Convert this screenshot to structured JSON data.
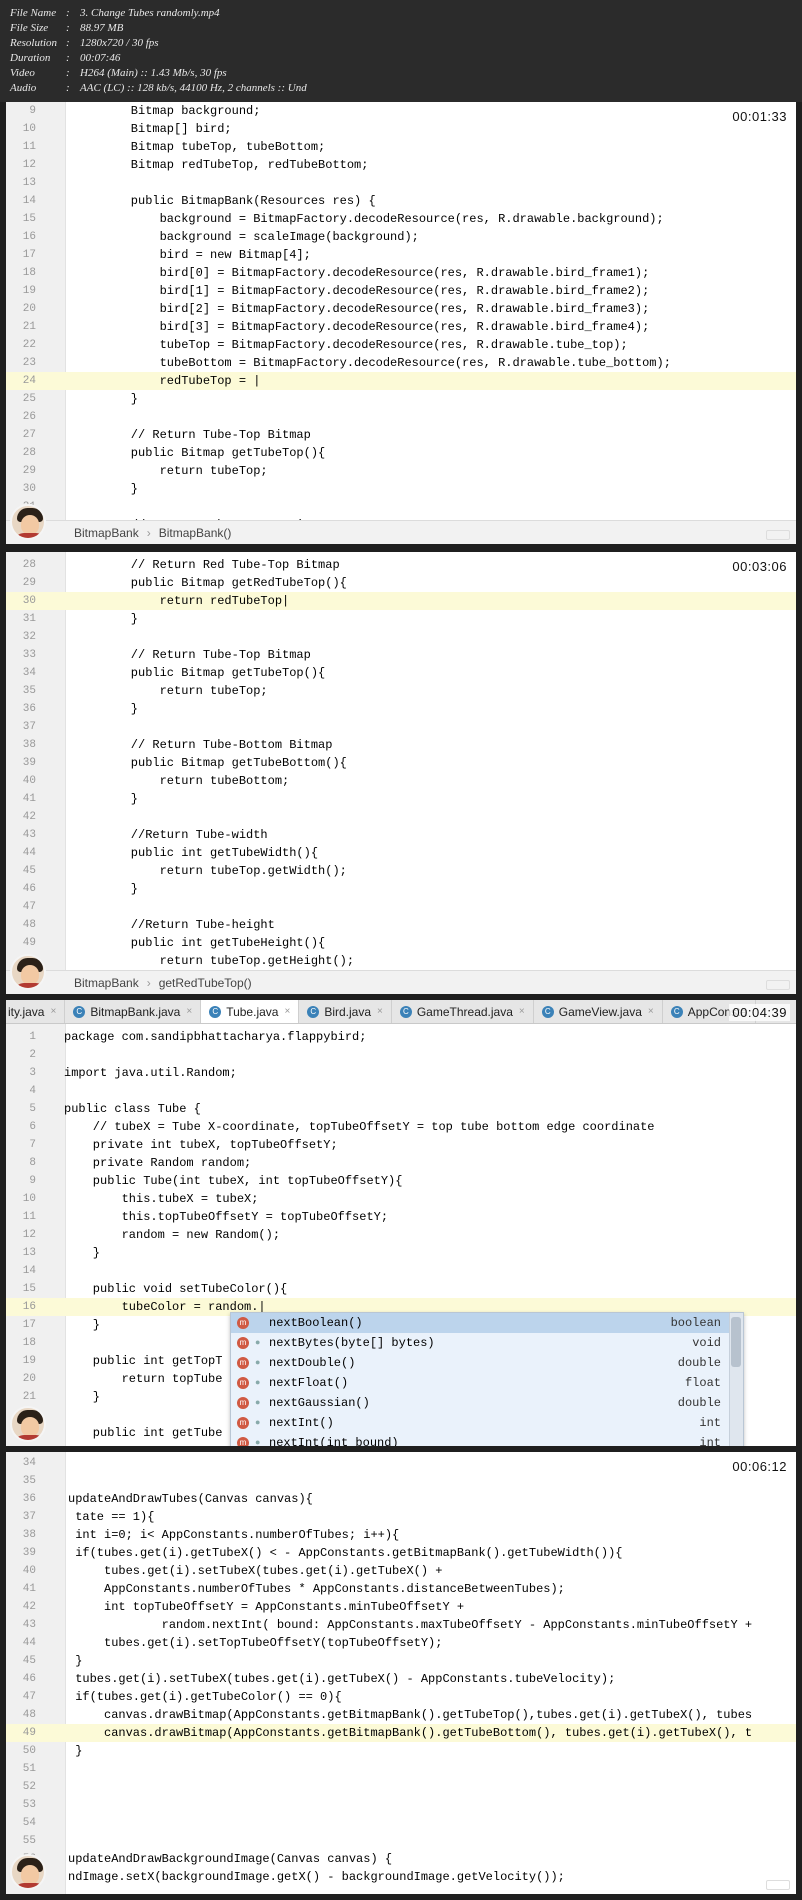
{
  "file_info": [
    {
      "key": "File Name",
      "value": "3. Change Tubes randomly.mp4"
    },
    {
      "key": "File Size",
      "value": "88.97 MB"
    },
    {
      "key": "Resolution",
      "value": "1280x720 / 30 fps"
    },
    {
      "key": "Duration",
      "value": "00:07:46"
    },
    {
      "key": "Video",
      "value": "H264 (Main) :: 1.43 Mb/s, 30 fps"
    },
    {
      "key": "Audio",
      "value": "AAC (LC) :: 128 kb/s, 44100 Hz, 2 channels :: Und"
    }
  ],
  "panels": [
    {
      "timestamp": "00:01:33",
      "breadcrumb": [
        "BitmapBank",
        "BitmapBank()"
      ],
      "lines": [
        {
          "n": "9",
          "t": "    Bitmap background;"
        },
        {
          "n": "10",
          "t": "    Bitmap[] bird;"
        },
        {
          "n": "11",
          "t": "    Bitmap tubeTop, tubeBottom;"
        },
        {
          "n": "12",
          "t": "    Bitmap redTubeTop, redTubeBottom;"
        },
        {
          "n": "13",
          "t": ""
        },
        {
          "n": "14",
          "t": "    public BitmapBank(Resources res) {"
        },
        {
          "n": "15",
          "t": "        background = BitmapFactory.decodeResource(res, R.drawable.background);"
        },
        {
          "n": "16",
          "t": "        background = scaleImage(background);"
        },
        {
          "n": "17",
          "t": "        bird = new Bitmap[4];"
        },
        {
          "n": "18",
          "t": "        bird[0] = BitmapFactory.decodeResource(res, R.drawable.bird_frame1);"
        },
        {
          "n": "19",
          "t": "        bird[1] = BitmapFactory.decodeResource(res, R.drawable.bird_frame2);"
        },
        {
          "n": "20",
          "t": "        bird[2] = BitmapFactory.decodeResource(res, R.drawable.bird_frame3);"
        },
        {
          "n": "21",
          "t": "        bird[3] = BitmapFactory.decodeResource(res, R.drawable.bird_frame4);"
        },
        {
          "n": "22",
          "t": "        tubeTop = BitmapFactory.decodeResource(res, R.drawable.tube_top);"
        },
        {
          "n": "23",
          "t": "        tubeBottom = BitmapFactory.decodeResource(res, R.drawable.tube_bottom);"
        },
        {
          "n": "24",
          "t": "        redTubeTop = |",
          "cur": true
        },
        {
          "n": "25",
          "t": "    }"
        },
        {
          "n": "26",
          "t": ""
        },
        {
          "n": "27",
          "t": "    // Return Tube-Top Bitmap"
        },
        {
          "n": "28",
          "t": "    public Bitmap getTubeTop(){"
        },
        {
          "n": "29",
          "t": "        return tubeTop;"
        },
        {
          "n": "30",
          "t": "    }"
        },
        {
          "n": "31",
          "t": ""
        },
        {
          "n": "32",
          "t": "    // Return Tube-Bottom Bitmap"
        }
      ]
    },
    {
      "timestamp": "00:03:06",
      "breadcrumb": [
        "BitmapBank",
        "getRedTubeTop()"
      ],
      "lines": [
        {
          "n": "28",
          "t": "    // Return Red Tube-Top Bitmap"
        },
        {
          "n": "29",
          "t": "    public Bitmap getRedTubeTop(){"
        },
        {
          "n": "30",
          "t": "        return redTubeTop|",
          "cur": true
        },
        {
          "n": "31",
          "t": "    }"
        },
        {
          "n": "32",
          "t": ""
        },
        {
          "n": "33",
          "t": "    // Return Tube-Top Bitmap"
        },
        {
          "n": "34",
          "t": "    public Bitmap getTubeTop(){"
        },
        {
          "n": "35",
          "t": "        return tubeTop;"
        },
        {
          "n": "36",
          "t": "    }"
        },
        {
          "n": "37",
          "t": ""
        },
        {
          "n": "38",
          "t": "    // Return Tube-Bottom Bitmap"
        },
        {
          "n": "39",
          "t": "    public Bitmap getTubeBottom(){"
        },
        {
          "n": "40",
          "t": "        return tubeBottom;"
        },
        {
          "n": "41",
          "t": "    }"
        },
        {
          "n": "42",
          "t": ""
        },
        {
          "n": "43",
          "t": "    //Return Tube-width"
        },
        {
          "n": "44",
          "t": "    public int getTubeWidth(){"
        },
        {
          "n": "45",
          "t": "        return tubeTop.getWidth();"
        },
        {
          "n": "46",
          "t": "    }"
        },
        {
          "n": "47",
          "t": ""
        },
        {
          "n": "48",
          "t": "    //Return Tube-height"
        },
        {
          "n": "49",
          "t": "    public int getTubeHeight(){"
        },
        {
          "n": "50",
          "t": "        return tubeTop.getHeight();"
        }
      ]
    },
    {
      "timestamp": "00:04:39",
      "tabs": [
        {
          "label": "ity.java",
          "icon": "c-class-icon",
          "close": true,
          "active": false
        },
        {
          "label": "BitmapBank.java",
          "icon": "c-class-icon",
          "close": true,
          "active": false
        },
        {
          "label": "Tube.java",
          "icon": "c-class-icon",
          "close": true,
          "active": true
        },
        {
          "label": "Bird.java",
          "icon": "c-class-icon",
          "close": true,
          "active": false
        },
        {
          "label": "GameThread.java",
          "icon": "c-class-icon",
          "close": true,
          "active": false
        },
        {
          "label": "GameView.java",
          "icon": "c-class-icon",
          "close": true,
          "active": false
        },
        {
          "label": "AppConsta",
          "icon": "c-class-icon",
          "close": false,
          "active": false
        }
      ],
      "lines": [
        {
          "n": "1",
          "t": "package com.sandipbhattacharya.flappybird;"
        },
        {
          "n": "2",
          "t": ""
        },
        {
          "n": "3",
          "t": "import java.util.Random;"
        },
        {
          "n": "4",
          "t": ""
        },
        {
          "n": "5",
          "t": "public class Tube {"
        },
        {
          "n": "6",
          "t": "    // tubeX = Tube X-coordinate, topTubeOffsetY = top tube bottom edge coordinate"
        },
        {
          "n": "7",
          "t": "    private int tubeX, topTubeOffsetY;"
        },
        {
          "n": "8",
          "t": "    private Random random;"
        },
        {
          "n": "9",
          "t": "    public Tube(int tubeX, int topTubeOffsetY){"
        },
        {
          "n": "10",
          "t": "        this.tubeX = tubeX;"
        },
        {
          "n": "11",
          "t": "        this.topTubeOffsetY = topTubeOffsetY;"
        },
        {
          "n": "12",
          "t": "        random = new Random();"
        },
        {
          "n": "13",
          "t": "    }"
        },
        {
          "n": "14",
          "t": ""
        },
        {
          "n": "15",
          "t": "    public void setTubeColor(){"
        },
        {
          "n": "16",
          "t": "        tubeColor = random.|",
          "cur": true
        },
        {
          "n": "17",
          "t": "    }"
        },
        {
          "n": "18",
          "t": ""
        },
        {
          "n": "19",
          "t": "    public int getTopT"
        },
        {
          "n": "20",
          "t": "        return topTube"
        },
        {
          "n": "21",
          "t": "    }"
        },
        {
          "n": "22",
          "t": ""
        },
        {
          "n": "23",
          "t": "    public int getTube"
        }
      ],
      "autocomplete": [
        {
          "name": "nextBoolean()",
          "type": "boolean",
          "selected": true
        },
        {
          "name": "nextBytes(byte[] bytes)",
          "type": "void",
          "selected": false
        },
        {
          "name": "nextDouble()",
          "type": "double",
          "selected": false
        },
        {
          "name": "nextFloat()",
          "type": "float",
          "selected": false
        },
        {
          "name": "nextGaussian()",
          "type": "double",
          "selected": false
        },
        {
          "name": "nextInt()",
          "type": "int",
          "selected": false
        },
        {
          "name": "nextInt(int bound)",
          "type": "int",
          "selected": false
        }
      ]
    },
    {
      "timestamp": "00:06:12",
      "lines": [
        {
          "n": "34",
          "t": ""
        },
        {
          "n": "35",
          "t": ""
        },
        {
          "n": "36",
          "t": "updateAndDrawTubes(Canvas canvas){"
        },
        {
          "n": "37",
          "t": " tate == 1){"
        },
        {
          "n": "38",
          "t": " int i=0; i< AppConstants.numberOfTubes; i++){"
        },
        {
          "n": "39",
          "t": " if(tubes.get(i).getTubeX() < - AppConstants.getBitmapBank().getTubeWidth()){"
        },
        {
          "n": "40",
          "t": "     tubes.get(i).setTubeX(tubes.get(i).getTubeX() +"
        },
        {
          "n": "41",
          "t": "     AppConstants.numberOfTubes * AppConstants.distanceBetweenTubes);"
        },
        {
          "n": "42",
          "t": "     int topTubeOffsetY = AppConstants.minTubeOffsetY +"
        },
        {
          "n": "43",
          "t": "             random.nextInt( bound: AppConstants.maxTubeOffsetY - AppConstants.minTubeOffsetY +"
        },
        {
          "n": "44",
          "t": "     tubes.get(i).setTopTubeOffsetY(topTubeOffsetY);"
        },
        {
          "n": "45",
          "t": " }"
        },
        {
          "n": "46",
          "t": " tubes.get(i).setTubeX(tubes.get(i).getTubeX() - AppConstants.tubeVelocity);"
        },
        {
          "n": "47",
          "t": " if(tubes.get(i).getTubeColor() == 0){"
        },
        {
          "n": "48",
          "t": "     canvas.drawBitmap(AppConstants.getBitmapBank().getTubeTop(),tubes.get(i).getTubeX(), tubes"
        },
        {
          "n": "49",
          "t": "     canvas.drawBitmap(AppConstants.getBitmapBank().getTubeBottom(), tubes.get(i).getTubeX(), t",
          "cur": true
        },
        {
          "n": "50",
          "t": " }"
        },
        {
          "n": "51",
          "t": ""
        },
        {
          "n": "52",
          "t": ""
        },
        {
          "n": "53",
          "t": ""
        },
        {
          "n": "54",
          "t": ""
        },
        {
          "n": "55",
          "t": ""
        },
        {
          "n": "56",
          "t": "updateAndDrawBackgroundImage(Canvas canvas) {"
        },
        {
          "n": "57",
          "t": "ndImage.setX(backgroundImage.getX() - backgroundImage.getVelocity());"
        }
      ]
    }
  ]
}
